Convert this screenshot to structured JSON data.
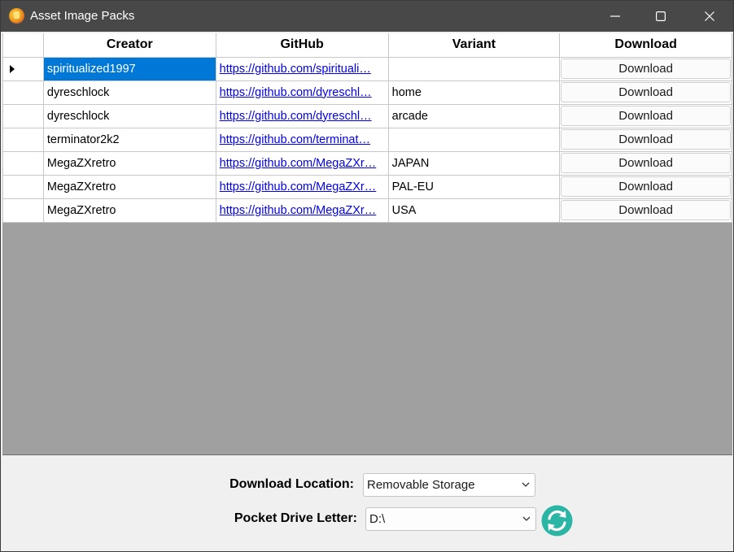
{
  "window": {
    "title": "Asset Image Packs"
  },
  "grid": {
    "columns": [
      "Creator",
      "GitHub",
      "Variant",
      "Download"
    ],
    "rows": [
      {
        "creator": "spiritualized1997",
        "github": "https://github.com/spirituali…",
        "variant": "",
        "download": "Download",
        "selected": true
      },
      {
        "creator": "dyreschlock",
        "github": "https://github.com/dyreschl…",
        "variant": "home",
        "download": "Download"
      },
      {
        "creator": "dyreschlock",
        "github": "https://github.com/dyreschl…",
        "variant": "arcade",
        "download": "Download"
      },
      {
        "creator": "terminator2k2",
        "github": "https://github.com/terminat…",
        "variant": "",
        "download": "Download"
      },
      {
        "creator": "MegaZXretro",
        "github": "https://github.com/MegaZXr…",
        "variant": "JAPAN",
        "download": "Download"
      },
      {
        "creator": "MegaZXretro",
        "github": "https://github.com/MegaZXr…",
        "variant": "PAL-EU",
        "download": "Download"
      },
      {
        "creator": "MegaZXretro",
        "github": "https://github.com/MegaZXr…",
        "variant": "USA",
        "download": "Download"
      }
    ]
  },
  "form": {
    "download_location_label": "Download Location:",
    "download_location_value": "Removable Storage",
    "drive_letter_label": "Pocket Drive Letter:",
    "drive_letter_value": "D:\\"
  },
  "icons": {
    "app": "app-icon",
    "minimize": "minimize-icon",
    "maximize": "maximize-icon",
    "close": "close-icon",
    "row_selector": "row-selector-arrow-icon",
    "dropdown": "chevron-down-icon",
    "refresh": "refresh-icon"
  },
  "colors": {
    "titlebar": "#484848",
    "selection": "#0078d7",
    "link": "#0000ee",
    "empty_grid": "#a0a0a0",
    "refresh_icon": "#2ab5a5"
  }
}
